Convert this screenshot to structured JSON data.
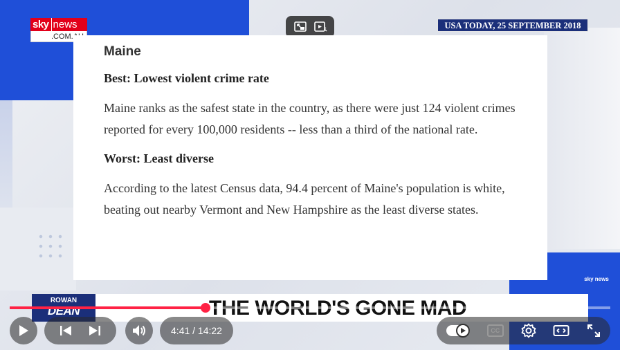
{
  "branding": {
    "logo_sky": "sky",
    "logo_news": "news",
    "logo_domain": ".COM.AU",
    "mini_logo": "sky news"
  },
  "source_banner": "USA TODAY, 25 SEPTEMBER 2018",
  "article": {
    "state": "Maine",
    "best_heading": "Best: Lowest violent crime rate",
    "best_text": "Maine ranks as the safest state in the country, as there were just 124 violent crimes reported for every 100,000 residents -- less than a third of the national rate.",
    "worst_heading": "Worst: Least diverse",
    "worst_text": "According to the latest Census data, 94.4 percent of Maine's population is white, beating out nearby Vermont and New Hampshire as the least diverse states."
  },
  "lower_third": {
    "show_line1": "ROWAN",
    "show_line2": "DEAN",
    "headline": "THE WORLD'S GONE MAD"
  },
  "player": {
    "time_display": "4:41 / 14:22",
    "progress": 0.326,
    "accent_color": "#ff2244",
    "icons": [
      "picture-in-picture-icon",
      "clip-icon",
      "play-icon",
      "previous-icon",
      "next-icon",
      "volume-icon",
      "autoplay-toggle",
      "captions-icon",
      "settings-icon",
      "theater-icon",
      "fullscreen-icon"
    ],
    "captions_label": "CC"
  },
  "colors": {
    "brand_blue": "#1f4fd8",
    "banner_navy": "#1b2f7a",
    "sky_red": "#e2001a"
  }
}
